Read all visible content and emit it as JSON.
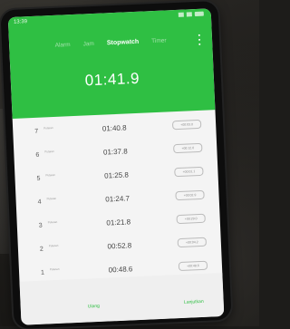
{
  "status": {
    "time": "13:39"
  },
  "tabs": [
    {
      "label": "Alarm",
      "active": false
    },
    {
      "label": "Jam",
      "active": false
    },
    {
      "label": "Stopwatch",
      "active": true
    },
    {
      "label": "Timer",
      "active": false
    }
  ],
  "stopwatch": {
    "elapsed": "01:41.9",
    "laps": [
      {
        "num": "7",
        "tag": "Putaran",
        "time": "01:40.8",
        "diff": "+00:03.0"
      },
      {
        "num": "6",
        "tag": "Putaran",
        "time": "01:37.8",
        "diff": "+00:12.0"
      },
      {
        "num": "5",
        "tag": "Putaran",
        "time": "01:25.8",
        "diff": "+00:01.1"
      },
      {
        "num": "4",
        "tag": "Putaran",
        "time": "01:24.7",
        "diff": "+00:02.9"
      },
      {
        "num": "3",
        "tag": "Putaran",
        "time": "01:21.8",
        "diff": "+00:29.0"
      },
      {
        "num": "2",
        "tag": "Putaran",
        "time": "00:52.8",
        "diff": "+00:04.2"
      },
      {
        "num": "1",
        "tag": "Putaran",
        "time": "00:48.6",
        "diff": "+00:48.6"
      }
    ]
  },
  "buttons": {
    "left": "Ulang",
    "right": "Lanjutkan"
  },
  "colors": {
    "accent": "#2fbf43",
    "header_bg": "#2fbf43",
    "screen_bg": "#f4f4f4"
  }
}
